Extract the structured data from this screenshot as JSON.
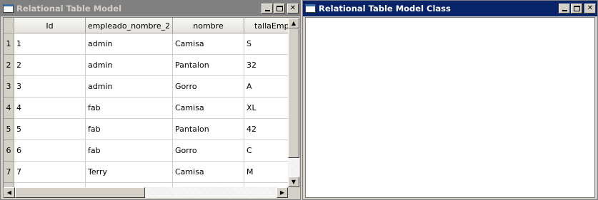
{
  "windows": {
    "left": {
      "title": "Relational Table Model",
      "active": false
    },
    "right": {
      "title": "Relational Table Model Class",
      "active": true
    }
  },
  "table": {
    "columns": [
      "Id",
      "empleado_nombre_2",
      "nombre",
      "tallaEmple"
    ],
    "rows": [
      {
        "header": "1",
        "cells": [
          "1",
          "admin",
          "Camisa",
          "S"
        ]
      },
      {
        "header": "2",
        "cells": [
          "2",
          "admin",
          "Pantalon",
          "32"
        ]
      },
      {
        "header": "3",
        "cells": [
          "3",
          "admin",
          "Gorro",
          "A"
        ]
      },
      {
        "header": "4",
        "cells": [
          "4",
          "fab",
          "Camisa",
          "XL"
        ]
      },
      {
        "header": "5",
        "cells": [
          "5",
          "fab",
          "Pantalon",
          "42"
        ]
      },
      {
        "header": "6",
        "cells": [
          "6",
          "fab",
          "Gorro",
          "C"
        ]
      },
      {
        "header": "7",
        "cells": [
          "7",
          "Terry",
          "Camisa",
          "M"
        ]
      },
      {
        "header": "8",
        "cells": [
          "",
          "",
          "",
          ""
        ]
      }
    ]
  },
  "scrollbars": {
    "vertical_position": 0.0,
    "horizontal_position": 0.0
  },
  "icons": {
    "minimize": "minimize-icon",
    "maximize": "maximize-icon",
    "close": "close-icon",
    "scroll_up": "arrow-up-icon",
    "scroll_down": "arrow-down-icon",
    "scroll_left": "arrow-left-icon",
    "scroll_right": "arrow-right-icon"
  },
  "colors": {
    "active_title": "#0a246a",
    "inactive_title": "#808080",
    "face": "#d4d0c8"
  }
}
